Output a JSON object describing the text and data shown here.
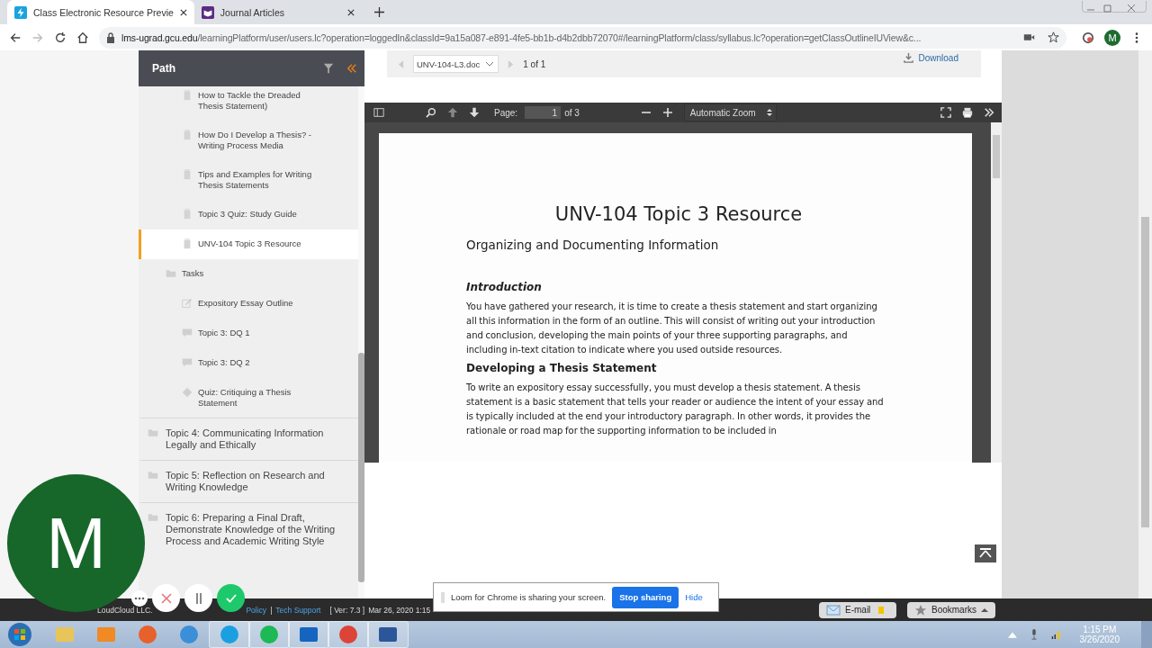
{
  "browser": {
    "tabs": [
      {
        "title": "Class Electronic Resource Previe",
        "selected": true,
        "kind": "bolt"
      },
      {
        "title": "Journal Articles",
        "selected": false,
        "kind": "journal"
      }
    ],
    "url_host": "lms-ugrad.gcu.edu",
    "url_path": "/learningPlatform/user/users.lc?operation=loggedIn&classId=9a15a087-e891-4fe5-bb1b-d4b2dbb72070#/learningPlatform/class/syllabus.lc?operation=getClassOutlineIUView&c...",
    "profile": "M"
  },
  "sidebar": {
    "title": "Path",
    "items": [
      {
        "label": "How to Tackle the Dreaded Thesis Statement)",
        "kind": "resource",
        "selected": false
      },
      {
        "label": "How Do I Develop a Thesis? - Writing Process Media",
        "kind": "resource",
        "selected": false
      },
      {
        "label": "Tips and Examples for Writing Thesis Statements",
        "kind": "resource",
        "selected": false
      },
      {
        "label": "Topic 3 Quiz: Study Guide",
        "kind": "resource",
        "selected": false
      },
      {
        "label": "UNV-104 Topic 3 Resource",
        "kind": "resource",
        "selected": true
      },
      {
        "label": "Tasks",
        "kind": "folder",
        "selected": false
      },
      {
        "label": "Expository Essay Outline",
        "kind": "task",
        "selected": false
      },
      {
        "label": "Topic 3: DQ 1",
        "kind": "discussion",
        "selected": false
      },
      {
        "label": "Topic 3: DQ 2",
        "kind": "discussion",
        "selected": false
      },
      {
        "label": "Quiz: Critiquing a Thesis Statement",
        "kind": "quiz",
        "selected": false
      },
      {
        "label": "Topic 4: Communicating Information Legally and Ethically",
        "kind": "topic",
        "selected": false
      },
      {
        "label": "Topic 5: Reflection on Research and Writing Knowledge",
        "kind": "topic",
        "selected": false
      },
      {
        "label": "Topic 6: Preparing a Final Draft, Demonstrate Knowledge of the Writing Process and Academic Writing Style",
        "kind": "topic",
        "selected": false
      }
    ]
  },
  "file_bar": {
    "file": "UNV-104-L3.doc",
    "count": "1 of 1",
    "download": "Download"
  },
  "pdf_viewer": {
    "page_label": "Page:",
    "page": "1",
    "page_total": "of 3",
    "zoom": "Automatic Zoom"
  },
  "document": {
    "title": "UNV-104 Topic 3 Resource",
    "subtitle": "Organizing and Documenting Information",
    "sections": [
      {
        "heading": "Introduction",
        "kind": "italic",
        "text": "You have gathered your research, it is time to create a thesis statement and start organizing all this information in the form of an outline. This will consist of writing out your introduction and conclusion, developing the main points of your three supporting paragraphs, and including in-text citation to indicate where you used outside resources."
      },
      {
        "heading": "Developing a Thesis Statement",
        "kind": "plain",
        "text": "To write an expository essay successfully, you must develop a thesis statement.  A thesis statement is a basic statement that tells your reader or audience the intent of your essay and is typically included at the end your introductory paragraph.  In other words, it provides the rationale or road map for the supporting information to be included in"
      }
    ]
  },
  "footer": {
    "links": [
      "LoudCloud LLC.",
      "Policy",
      "Tech Support"
    ],
    "separator": "|",
    "version": "[ Ver: 7.3 ]",
    "date": "Mar 26, 2020  1:15",
    "email": "E-mail",
    "bookmarks": "Bookmarks"
  },
  "loom": {
    "avatar": "M",
    "message": "Loom for Chrome is sharing your screen.",
    "stop": "Stop sharing",
    "hide": "Hide"
  },
  "taskbar": {
    "time": "1:15 PM",
    "date": "3/26/2020"
  }
}
